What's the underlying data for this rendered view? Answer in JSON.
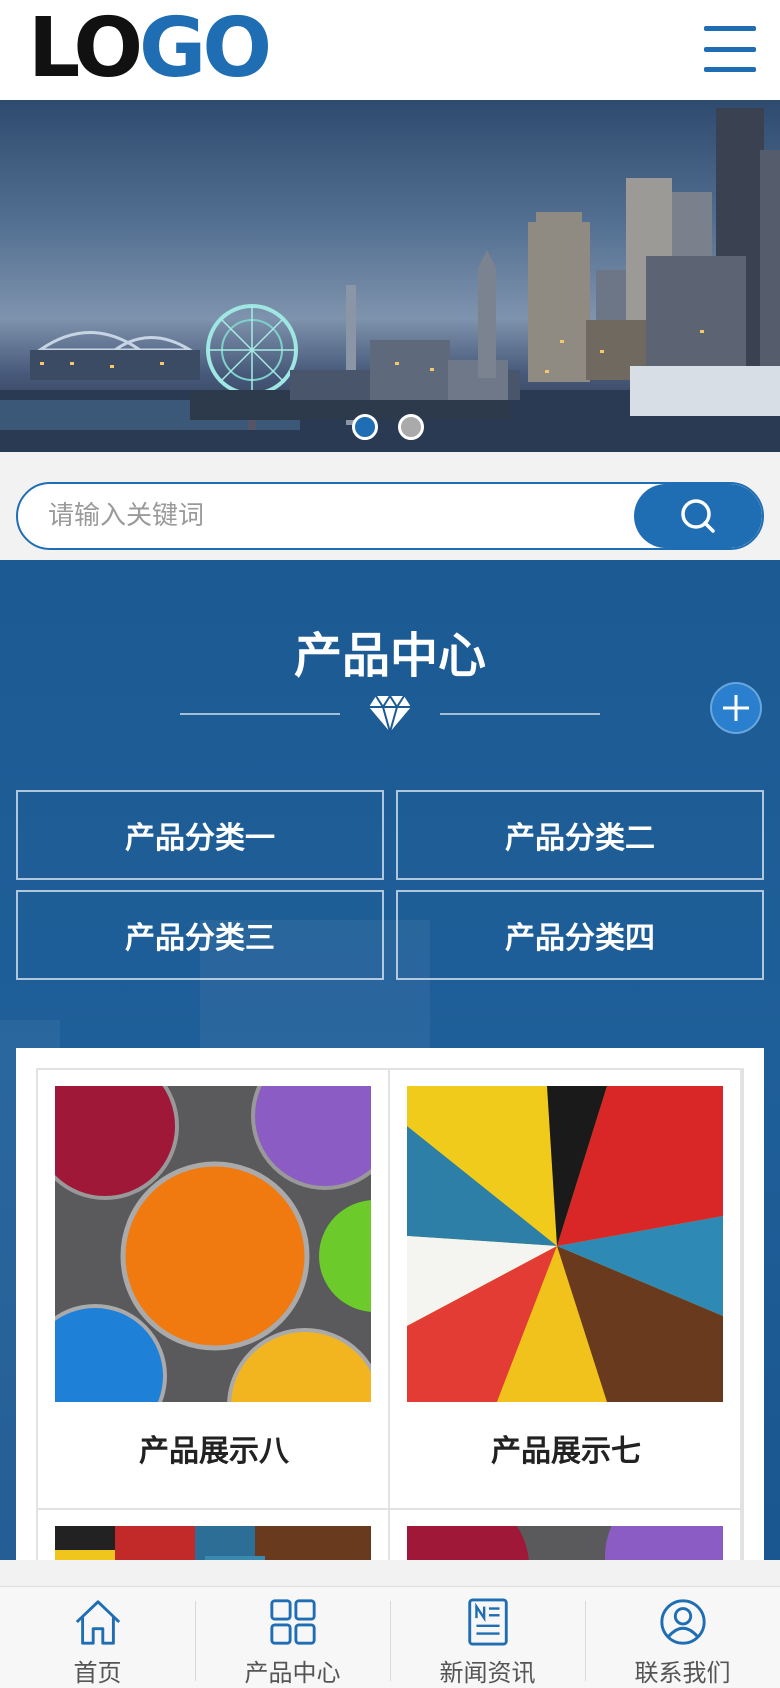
{
  "header": {
    "logo_part1": "LO",
    "logo_part2": "GO"
  },
  "banner": {
    "slides": 2,
    "active_slide": 1
  },
  "search": {
    "placeholder": "请输入关键词"
  },
  "products": {
    "title": "产品中心",
    "categories": [
      "产品分类一",
      "产品分类二",
      "产品分类三",
      "产品分类四"
    ],
    "items": [
      {
        "name": "产品展示八"
      },
      {
        "name": "产品展示七"
      },
      {
        "name": ""
      },
      {
        "name": ""
      }
    ]
  },
  "bottom_nav": {
    "items": [
      {
        "label": "首页",
        "icon": "home-icon"
      },
      {
        "label": "产品中心",
        "icon": "grid-icon"
      },
      {
        "label": "新闻资讯",
        "icon": "news-icon"
      },
      {
        "label": "联系我们",
        "icon": "user-icon"
      }
    ]
  },
  "colors": {
    "accent": "#1f6db3",
    "section_bg": "#1c5a93"
  }
}
